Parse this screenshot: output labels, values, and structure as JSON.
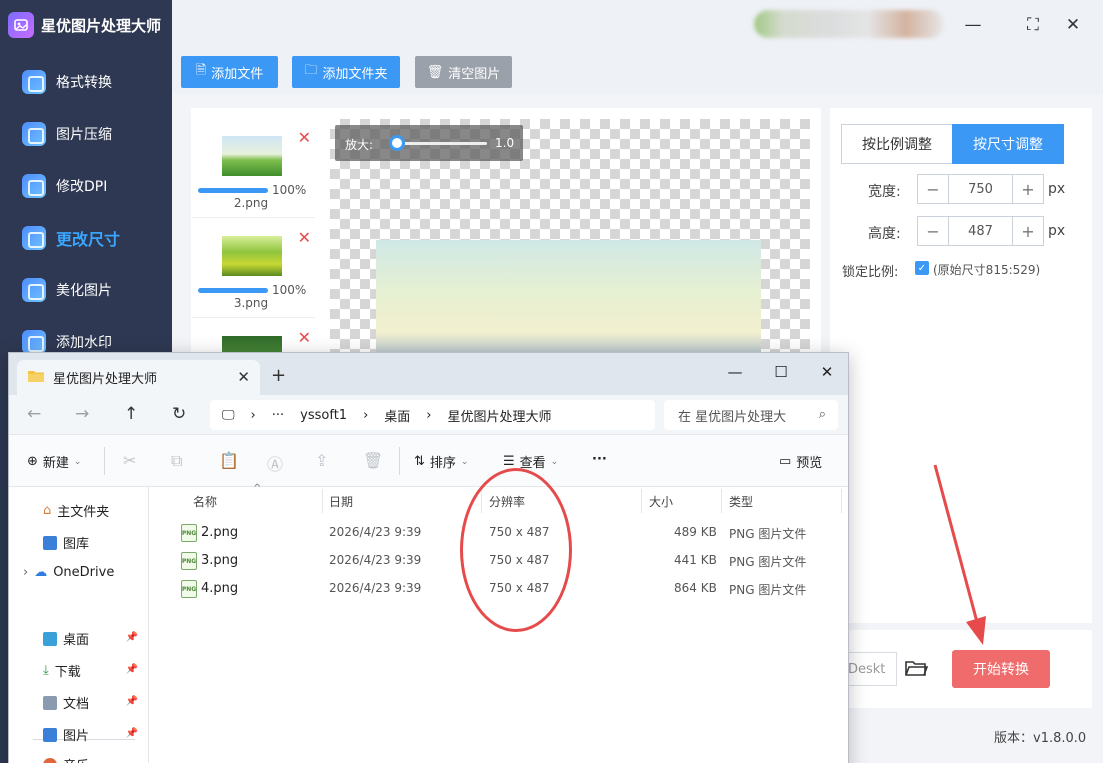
{
  "app": {
    "title": "星优图片处理大师",
    "version_label": "版本：v1.8.0.0"
  },
  "sidebar": {
    "items": [
      {
        "label": "格式转换",
        "active": false
      },
      {
        "label": "图片压缩",
        "active": false
      },
      {
        "label": "修改DPI",
        "active": false
      },
      {
        "label": "更改尺寸",
        "active": true
      },
      {
        "label": "美化图片",
        "active": false
      },
      {
        "label": "添加水印",
        "active": false
      }
    ]
  },
  "window_controls": {
    "minimize": "—",
    "maximize": "⛶",
    "close": "✕"
  },
  "toolbar": {
    "add_file": "添加文件",
    "add_folder": "添加文件夹",
    "clear_images": "清空图片"
  },
  "thumbnails": [
    {
      "name": "2.png",
      "progress": "100%"
    },
    {
      "name": "3.png",
      "progress": "100%"
    }
  ],
  "preview": {
    "zoom_label": "放大:",
    "zoom_value": "1.0"
  },
  "settings": {
    "mode_ratio": "按比例调整",
    "mode_size": "按尺寸调整",
    "width_label": "宽度:",
    "width_value": "750",
    "height_label": "高度:",
    "height_value": "487",
    "unit": "px",
    "lock_label": "锁定比例:",
    "lock_text": "(原始尺寸815:529)",
    "output_path": "Deskt",
    "start_button": "开始转换"
  },
  "explorer": {
    "tab_title": "星优图片处理大师",
    "breadcrumb": [
      "···",
      "yssoft1",
      "桌面",
      "星优图片处理大师"
    ],
    "search_placeholder": "在 星优图片处理大",
    "commands": {
      "new": "新建",
      "sort": "排序",
      "view": "查看",
      "more": "···",
      "preview": "预览"
    },
    "nav": {
      "home": "主文件夹",
      "gallery": "图库",
      "onedrive": "OneDrive",
      "desktop": "桌面",
      "downloads": "下载",
      "documents": "文档",
      "pictures": "图片",
      "music": "音乐"
    },
    "columns": [
      "名称",
      "日期",
      "分辨率",
      "大小",
      "类型"
    ],
    "files": [
      {
        "name": "2.png",
        "date": "2026/4/23 9:39",
        "resolution": "750 x 487",
        "size": "489 KB",
        "type": "PNG 图片文件"
      },
      {
        "name": "3.png",
        "date": "2026/4/23 9:39",
        "resolution": "750 x 487",
        "size": "441 KB",
        "type": "PNG 图片文件"
      },
      {
        "name": "4.png",
        "date": "2026/4/23 9:39",
        "resolution": "750 x 487",
        "size": "864 KB",
        "type": "PNG 图片文件"
      }
    ]
  },
  "colors": {
    "accent": "#3c98f5",
    "start_button": "#f06b6b",
    "sidebar_bg": "#2e3852",
    "annotation": "#e64a4a"
  }
}
